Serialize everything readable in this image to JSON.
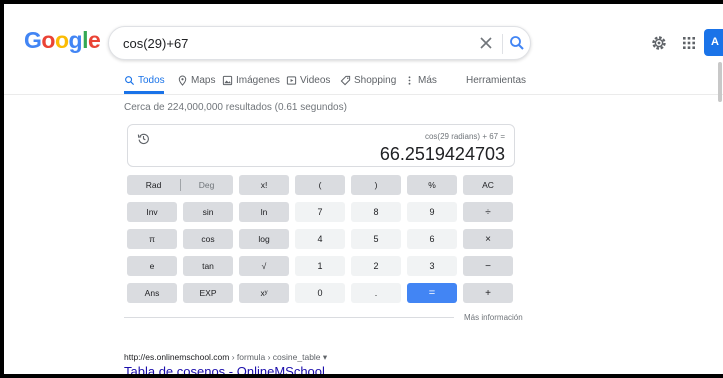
{
  "header": {
    "logo_letters": [
      "G",
      "o",
      "o",
      "g",
      "l",
      "e"
    ],
    "logo_colors": [
      "#4285f4",
      "#ea4335",
      "#fbbc05",
      "#4285f4",
      "#34a853",
      "#ea4335"
    ],
    "search_query": "cos(29)+67",
    "signin_label": "A"
  },
  "tabs": [
    {
      "label": "Todos",
      "icon": "search-icon",
      "active": true
    },
    {
      "label": "Maps",
      "icon": "map-pin-icon",
      "active": false
    },
    {
      "label": "Imágenes",
      "icon": "image-icon",
      "active": false
    },
    {
      "label": "Videos",
      "icon": "video-icon",
      "active": false
    },
    {
      "label": "Shopping",
      "icon": "tag-icon",
      "active": false
    },
    {
      "label": "Más",
      "icon": "more-vert-icon",
      "active": false
    },
    {
      "label": "Herramientas",
      "icon": "",
      "active": false
    }
  ],
  "result_stats": "Cerca de 224,000,000 resultados (0.61 segundos)",
  "calculator": {
    "expression": "cos(29 radians) + 67 =",
    "result": "66.2519424703",
    "mode_rad": "Rad",
    "mode_deg": "Deg",
    "keys": [
      [
        "x!",
        "(",
        ")",
        "%",
        "AC"
      ],
      [
        "Inv",
        "sin",
        "ln",
        "7",
        "8",
        "9",
        "÷"
      ],
      [
        "π",
        "cos",
        "log",
        "4",
        "5",
        "6",
        "×"
      ],
      [
        "e",
        "tan",
        "√",
        "1",
        "2",
        "3",
        "−"
      ],
      [
        "Ans",
        "EXP",
        "xʸ",
        "0",
        ".",
        "=",
        "+"
      ]
    ],
    "more_info": "Más información"
  },
  "result": {
    "url_domain": "http://es.onlinemschool.com",
    "url_path": " › formula › cosine_table",
    "url_caret": "▾",
    "title": "Tabla de cosenos - OnlineMSchool"
  },
  "colors": {
    "accent": "#1a73e8",
    "equals_key": "#4285f4",
    "link": "#1a0dab"
  }
}
